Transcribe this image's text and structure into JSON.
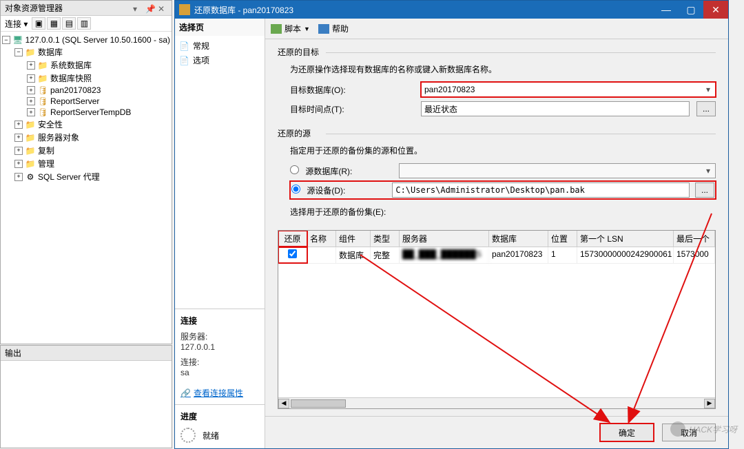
{
  "objectExplorer": {
    "title": "对象资源管理器",
    "connectLabel": "连接 ▾",
    "server": "127.0.0.1 (SQL Server 10.50.1600 - sa)",
    "nodes": {
      "databases": "数据库",
      "sysdb": "系统数据库",
      "snapshots": "数据库快照",
      "db1": "pan20170823",
      "db2": "ReportServer",
      "db3": "ReportServerTempDB",
      "security": "安全性",
      "serverObjects": "服务器对象",
      "replication": "复制",
      "management": "管理",
      "agent": "SQL Server 代理"
    }
  },
  "outputPane": {
    "title": "输出"
  },
  "dialog": {
    "title": "还原数据库 - pan20170823",
    "pageSel": {
      "header": "选择页",
      "general": "常规",
      "options": "选项"
    },
    "toolbar": {
      "script": "脚本",
      "help": "帮助"
    },
    "restoreTarget": {
      "groupTitle": "还原的目标",
      "desc": "为还原操作选择现有数据库的名称或键入新数据库名称。",
      "targetDbLabel": "目标数据库(O):",
      "targetDbValue": "pan20170823",
      "targetTimeLabel": "目标时间点(T):",
      "targetTimeValue": "最近状态",
      "browse": "..."
    },
    "restoreSource": {
      "groupTitle": "还原的源",
      "desc": "指定用于还原的备份集的源和位置。",
      "radioSourceDb": "源数据库(R):",
      "radioSourceDevice": "源设备(D):",
      "sourceDeviceValue": "C:\\Users\\Administrator\\Desktop\\pan.bak",
      "browse": "...",
      "backupSetsLabel": "选择用于还原的备份集(E):"
    },
    "grid": {
      "headers": [
        "还原",
        "名称",
        "组件",
        "类型",
        "服务器",
        "数据库",
        "位置",
        "第一个 LSN",
        "最后一个"
      ],
      "row": {
        "restore": true,
        "name": "",
        "component": "数据库",
        "type": "完整",
        "server": "██_███_██████S",
        "database": "pan20170823",
        "position": "1",
        "firstLsn": "15730000000242900061",
        "lastLsn": "1573000"
      }
    },
    "connection": {
      "header": "连接",
      "serverLabel": "服务器:",
      "serverVal": "127.0.0.1",
      "connLabel": "连接:",
      "connVal": "sa",
      "viewLink": "查看连接属性"
    },
    "progress": {
      "header": "进度",
      "status": "就绪"
    },
    "buttons": {
      "ok": "确定",
      "cancel": "取消"
    }
  },
  "watermark": "HACK学习呀"
}
